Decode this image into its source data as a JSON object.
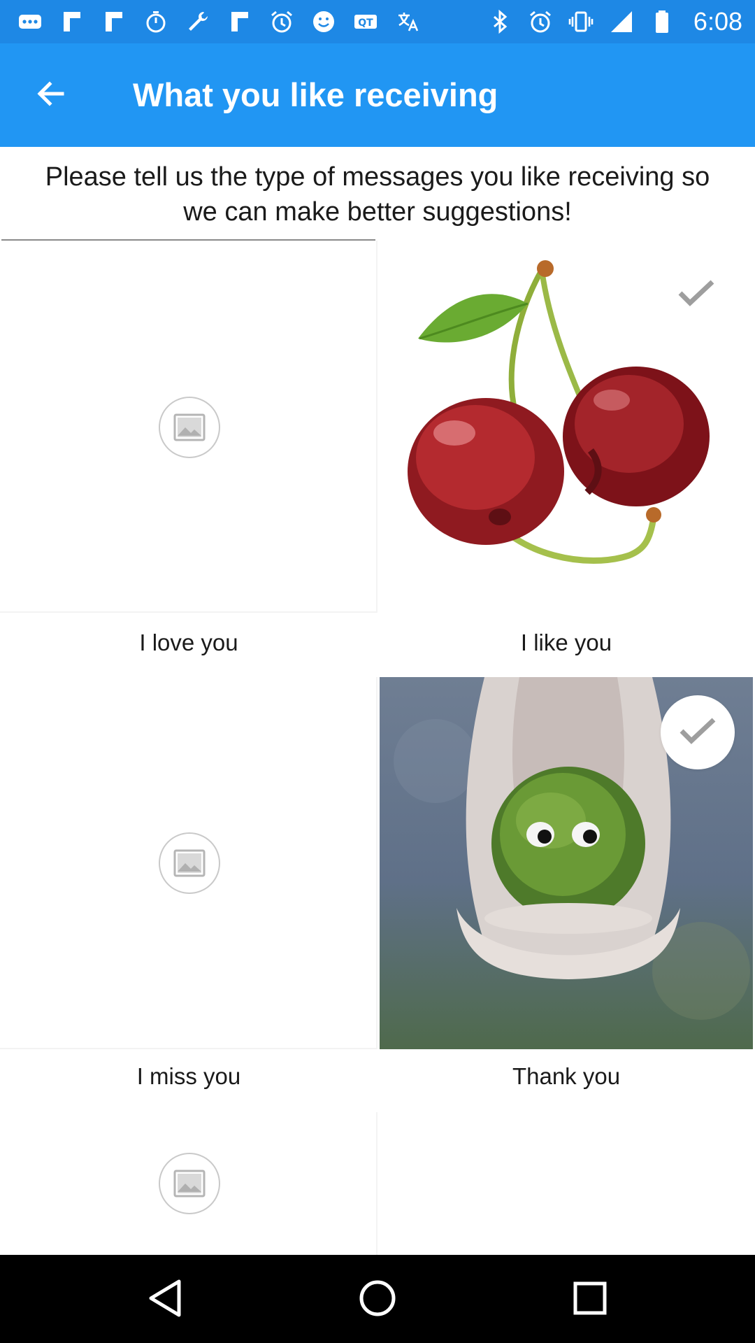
{
  "status_bar": {
    "time": "6:08",
    "left_icons": [
      "more-icon",
      "flipboard-icon",
      "flipboard-icon",
      "stopwatch-icon",
      "wrench-icon",
      "flipboard-icon",
      "alarm-icon",
      "smiley-icon",
      "qt-icon",
      "translate-icon"
    ],
    "right_icons": [
      "bluetooth-icon",
      "alarm-icon",
      "vibrate-icon",
      "signal-icon",
      "battery-icon"
    ]
  },
  "app_bar": {
    "title": "What you like receiving",
    "back_icon": "arrow-back-icon",
    "color": "#2196f3"
  },
  "intro": {
    "text": "Please tell us the type of messages you like receiving so we can make better suggestions!"
  },
  "tiles": [
    {
      "label": "I love you",
      "image": "placeholder",
      "selected": false
    },
    {
      "label": "I like you",
      "image": "cherries",
      "selected": true
    },
    {
      "label": "I miss you",
      "image": "placeholder",
      "selected": false
    },
    {
      "label": "Thank you",
      "image": "moss-creature-in-hands",
      "selected": true
    },
    {
      "label": "",
      "image": "placeholder",
      "selected": false
    }
  ],
  "nav_bar": {
    "icons": [
      "back-triangle-icon",
      "home-circle-icon",
      "recents-square-icon"
    ]
  }
}
